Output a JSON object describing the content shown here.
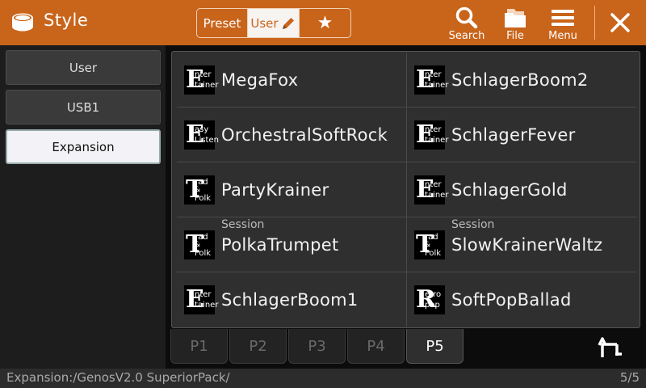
{
  "header": {
    "title": "Style",
    "app_icon": "drum-icon",
    "bank_tabs": [
      "Preset",
      "User",
      "★"
    ],
    "active_bank": "User",
    "actions": [
      {
        "label": "Search",
        "icon": "search-icon"
      },
      {
        "label": "File",
        "icon": "folder-icon"
      },
      {
        "label": "Menu",
        "icon": "menu-icon"
      }
    ],
    "close_icon": "close-icon",
    "accent_color": "#c9641b"
  },
  "sidebar": {
    "items": [
      {
        "label": "User"
      },
      {
        "label": "USB1"
      },
      {
        "label": "Expansion",
        "active": true
      }
    ]
  },
  "styles": [
    {
      "name": "MegaFox",
      "category": "Entertainer",
      "sub": ""
    },
    {
      "name": "SchlagerBoom2",
      "category": "Entertainer",
      "sub": ""
    },
    {
      "name": "OrchestralSoftRock",
      "category": "Easy Listen",
      "sub": ""
    },
    {
      "name": "SchlagerFever",
      "category": "Entertainer",
      "sub": ""
    },
    {
      "name": "PartyKrainer",
      "category": "Trad & Folk",
      "sub": ""
    },
    {
      "name": "SchlagerGold",
      "category": "Entertainer",
      "sub": ""
    },
    {
      "name": "PolkaTrumpet",
      "category": "Trad & Folk",
      "sub": "Session"
    },
    {
      "name": "SlowKrainerWaltz",
      "category": "Trad & Folk",
      "sub": "Session"
    },
    {
      "name": "SchlagerBoom1",
      "category": "Entertainer",
      "sub": ""
    },
    {
      "name": "SoftPopBallad",
      "category": "Retro pop",
      "sub": ""
    }
  ],
  "badges": {
    "ent": {
      "big": "E",
      "l1": "nter",
      "l2": "tainer"
    },
    "easy": {
      "big": "E",
      "l1": "asy",
      "l2": "Listen"
    },
    "trad": {
      "big": "T",
      "l1": "rad",
      "l2": "&",
      "l3": "Folk"
    },
    "retro": {
      "big": "R",
      "l1": "etro",
      "l2": "pop"
    }
  },
  "pages": {
    "tabs": [
      "P1",
      "P2",
      "P3",
      "P4",
      "P5"
    ],
    "active": "P5",
    "up_icon": "up-folder-icon"
  },
  "status": {
    "path": "Expansion:/GenosV2.0 SuperiorPack/",
    "page": "5/5"
  }
}
